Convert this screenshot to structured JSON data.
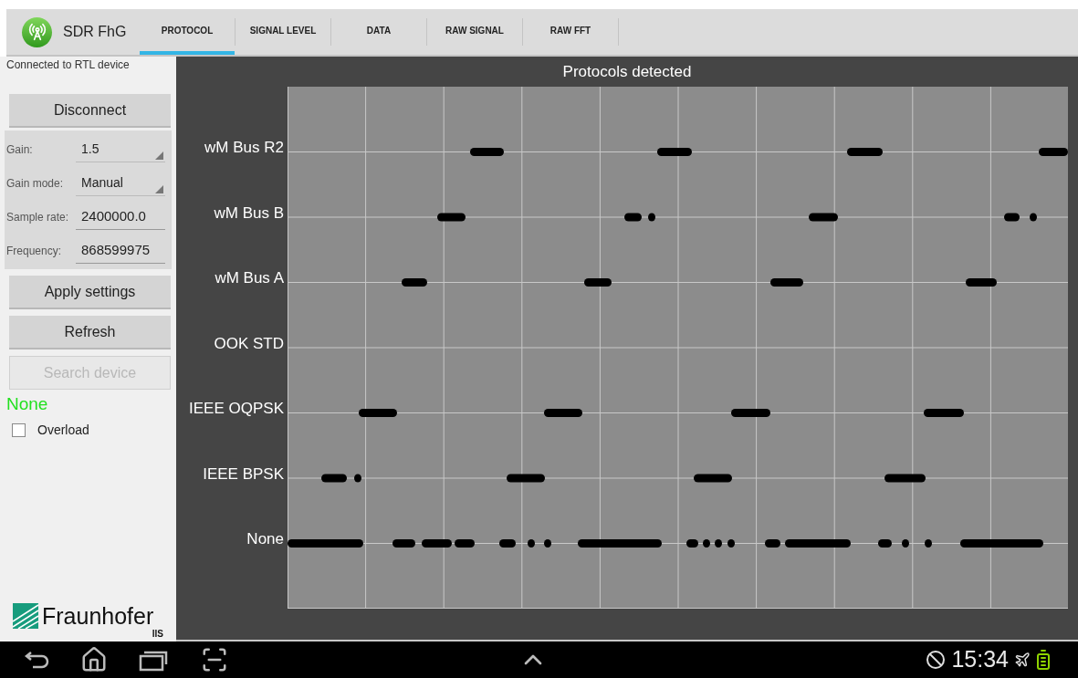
{
  "app": {
    "title": "SDR FhG"
  },
  "tabs": [
    {
      "label": "PROTOCOL",
      "selected": true
    },
    {
      "label": "SIGNAL LEVEL",
      "selected": false
    },
    {
      "label": "DATA",
      "selected": false
    },
    {
      "label": "RAW SIGNAL",
      "selected": false
    },
    {
      "label": "RAW FFT",
      "selected": false
    }
  ],
  "sidebar": {
    "status": "Connected to RTL device",
    "connection_button": {
      "label": "Disconnect",
      "disabled": false
    },
    "settings": [
      {
        "kind": "dropdown",
        "label": "Gain:",
        "value": "1.5"
      },
      {
        "kind": "dropdown",
        "label": "Gain mode:",
        "value": "Manual"
      },
      {
        "kind": "input",
        "label": "Sample rate:",
        "value": "2400000.0"
      },
      {
        "kind": "input",
        "label": "Frequency:",
        "value": "868599975"
      }
    ],
    "actions": [
      {
        "label": "Apply settings",
        "disabled": false
      },
      {
        "label": "Refresh",
        "disabled": false
      },
      {
        "label": "Search device",
        "disabled": true
      }
    ],
    "detected": "None",
    "overload": {
      "label": "Overload",
      "checked": false
    },
    "logo": {
      "name": "Fraunhofer",
      "sub": "IIS"
    }
  },
  "chart": {
    "title": "Protocols detected",
    "y_labels": [
      "wM Bus R2",
      "wM Bus B",
      "wM Bus A",
      "OOK STD",
      "IEEE OQPSK",
      "IEEE BPSK",
      "None"
    ]
  },
  "status_bar": {
    "time": "15:34"
  }
}
